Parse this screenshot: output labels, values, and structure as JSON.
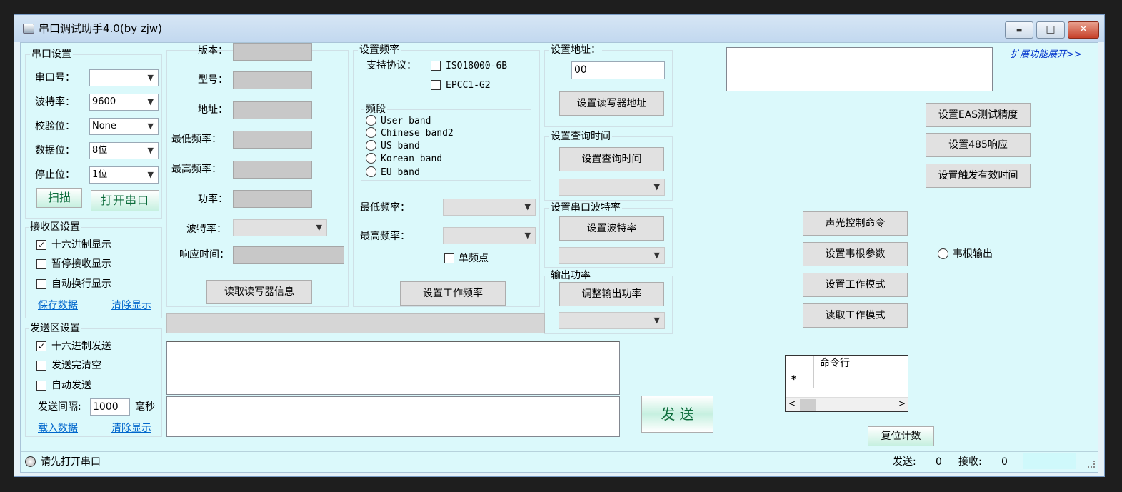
{
  "window": {
    "title": "串口调试助手4.0(by zjw)",
    "min_glyph": "▬",
    "max_glyph": "□",
    "close_glyph": "✕"
  },
  "serial": {
    "title": "串口设置",
    "port_label": "串口号：",
    "port_value": "",
    "baud_label": "波特率：",
    "baud_value": "9600",
    "parity_label": "校验位：",
    "parity_value": "None",
    "databits_label": "数据位：",
    "databits_value": "8位",
    "stopbits_label": "停止位：",
    "stopbits_value": "1位",
    "scan_label": "扫描",
    "open_label": "打开串口"
  },
  "receive": {
    "title": "接收区设置",
    "hex": "十六进制显示",
    "pause": "暂停接收显示",
    "wrap": "自动换行显示",
    "save": "保存数据",
    "clear": "清除显示"
  },
  "send_settings": {
    "title": "发送区设置",
    "hex": "十六进制发送",
    "clear_after": "发送完清空",
    "auto": "自动发送",
    "interval_label": "发送间隔:",
    "interval_value": "1000",
    "unit": "毫秒",
    "load": "载入数据",
    "clear": "清除显示"
  },
  "reader": {
    "version": "版本：",
    "model": "型号：",
    "address": "地址：",
    "min_freq": "最低频率：",
    "max_freq": "最高频率：",
    "power": "功率：",
    "baud": "波特率：",
    "response": "响应时间：",
    "read_btn": "读取读写器信息"
  },
  "freq": {
    "title": "设置频率",
    "protocol_label": "支持协议：",
    "protocols": [
      "ISO18000-6B",
      "EPCC1-G2"
    ],
    "band_title": "频段",
    "bands": [
      "User band",
      "Chinese band2",
      "US band",
      "Korean band",
      "EU band"
    ],
    "min_label": "最低频率：",
    "max_label": "最高频率：",
    "single": "单频点",
    "set_btn": "设置工作频率"
  },
  "address_box": {
    "title": "设置地址：",
    "value": "00",
    "btn": "设置读写器地址"
  },
  "query_time": {
    "title": "设置查询时间",
    "btn": "设置查询时间"
  },
  "serial_baud": {
    "title": "设置串口波特率",
    "btn": "设置波特率"
  },
  "output_power": {
    "title": "输出功率",
    "btn": "调整输出功率"
  },
  "right": {
    "expand": "扩展功能展开>>",
    "eas": "设置EAS测试精度",
    "r485": "设置485响应",
    "trigger": "设置触发有效时间",
    "sound": "声光控制命令",
    "wiegand_params": "设置韦根参数",
    "work_mode": "设置工作模式",
    "read_mode": "读取工作模式",
    "wiegand_out": "韦根输出",
    "grid_header": "命令行",
    "grid_new_row": "*",
    "send_btn": "发 送",
    "reset": "复位计数"
  },
  "status": {
    "text": "请先打开串口",
    "send_label": "发送:",
    "send_count": "0",
    "recv_label": "接收:",
    "recv_count": "0"
  }
}
